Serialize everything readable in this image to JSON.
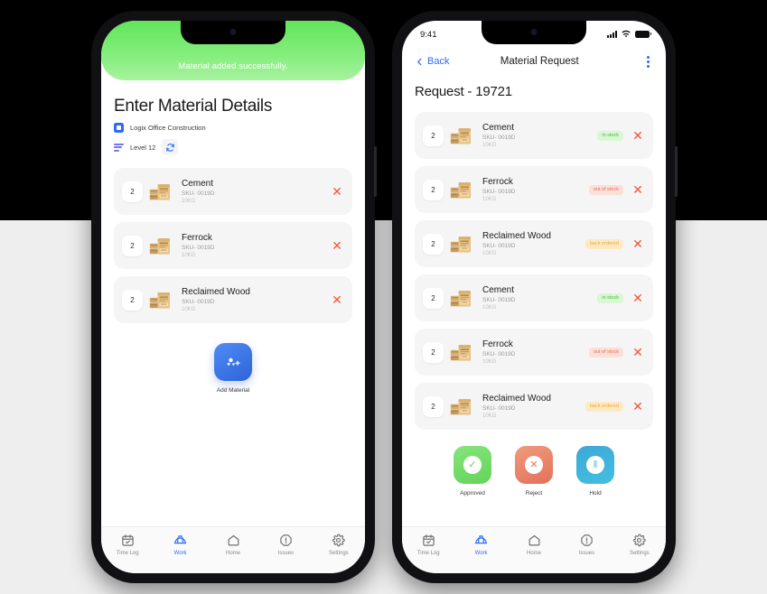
{
  "background": {
    "top_color": "#000000",
    "bottom_color": "#eeeeef"
  },
  "left_phone": {
    "toast": {
      "message": "Material added successfully.",
      "color": "#7aea72"
    },
    "page_title": "Enter Material Details",
    "project": {
      "name": "Logix Office Construction",
      "icon": "project-square-icon"
    },
    "level": {
      "name": "Level 12",
      "icon": "levels-icon",
      "sync_icon": "sync-icon"
    },
    "materials": [
      {
        "qty": "2",
        "name": "Cement",
        "sku": "SKU- 0019D",
        "weight": "10KG",
        "delete_icon": "close-icon"
      },
      {
        "qty": "2",
        "name": "Ferrock",
        "sku": "SKU- 0019D",
        "weight": "10KG",
        "delete_icon": "close-icon"
      },
      {
        "qty": "2",
        "name": "Reclaimed Wood",
        "sku": "SKU- 0019D",
        "weight": "10KG",
        "delete_icon": "close-icon"
      }
    ],
    "add_material": {
      "label": "Add Material",
      "icon": "add-material-icon",
      "color": "#2f63d8"
    },
    "tabbar": [
      {
        "label": "Time Log",
        "icon": "calendar-check-icon",
        "active": false
      },
      {
        "label": "Work",
        "icon": "hard-hat-icon",
        "active": true
      },
      {
        "label": "Home",
        "icon": "home-icon",
        "active": false
      },
      {
        "label": "Issues",
        "icon": "alert-octagon-icon",
        "active": false
      },
      {
        "label": "Settings",
        "icon": "gear-icon",
        "active": false
      }
    ]
  },
  "right_phone": {
    "status_bar": {
      "time": "9:41",
      "signal_icon": "cellular-signal-icon",
      "wifi_icon": "wifi-icon",
      "battery_icon": "battery-icon"
    },
    "nav": {
      "back_label": "Back",
      "back_icon": "chevron-left-icon",
      "title": "Material Request",
      "menu_icon": "kebab-menu-icon"
    },
    "request_title": "Request - 19721",
    "materials": [
      {
        "qty": "2",
        "name": "Cement",
        "sku": "SKU- 0019D",
        "weight": "10KG",
        "status": "in stock",
        "status_class": "in-stock",
        "delete_icon": "close-icon"
      },
      {
        "qty": "2",
        "name": "Ferrock",
        "sku": "SKU- 0019D",
        "weight": "10KG",
        "status": "out of stock",
        "status_class": "out-of-stock",
        "delete_icon": "close-icon"
      },
      {
        "qty": "2",
        "name": "Reclaimed Wood",
        "sku": "SKU- 0019D",
        "weight": "10KG",
        "status": "back ordered",
        "status_class": "back-ordered",
        "delete_icon": "close-icon"
      },
      {
        "qty": "2",
        "name": "Cement",
        "sku": "SKU- 0019D",
        "weight": "10KG",
        "status": "in stock",
        "status_class": "in-stock",
        "delete_icon": "close-icon"
      },
      {
        "qty": "2",
        "name": "Ferrock",
        "sku": "SKU- 0019D",
        "weight": "10KG",
        "status": "out of stock",
        "status_class": "out-of-stock",
        "delete_icon": "close-icon"
      },
      {
        "qty": "2",
        "name": "Reclaimed Wood",
        "sku": "SKU- 0019D",
        "weight": "10KG",
        "status": "back ordered",
        "status_class": "back-ordered",
        "delete_icon": "close-icon"
      }
    ],
    "actions": [
      {
        "label": "Approved",
        "icon": "check-circle-icon",
        "glyph": "✓",
        "key": "approved",
        "color": "#63d45a"
      },
      {
        "label": "Reject",
        "icon": "x-circle-icon",
        "glyph": "✕",
        "key": "reject",
        "color": "#e3725a"
      },
      {
        "label": "Hold",
        "icon": "pause-circle-icon",
        "glyph": "‖",
        "key": "hold",
        "color": "#43bfe0"
      }
    ],
    "tabbar": [
      {
        "label": "Time Log",
        "icon": "calendar-check-icon",
        "active": false
      },
      {
        "label": "Work",
        "icon": "hard-hat-icon",
        "active": true
      },
      {
        "label": "Home",
        "icon": "home-icon",
        "active": false
      },
      {
        "label": "Issues",
        "icon": "alert-octagon-icon",
        "active": false
      },
      {
        "label": "Settings",
        "icon": "gear-icon",
        "active": false
      }
    ]
  }
}
